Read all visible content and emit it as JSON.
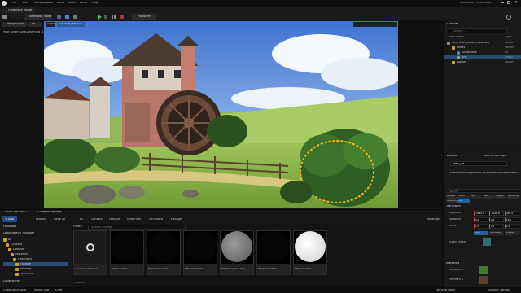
{
  "titlebar": {
    "project_tab": "FieldTrack_Asset",
    "window_title": "LowAngleV3_Shipped",
    "menu": [
      "File",
      "Edit",
      "Window",
      "Tools",
      "Build",
      "Select",
      "Actor",
      "Help"
    ]
  },
  "toolbar": {
    "mode_label": "Selection Mode",
    "platforms_label": "Platforms"
  },
  "viewport": {
    "perspective_label": "Perspective",
    "view_label": "Lit",
    "viewmode_label": "Show",
    "highlight_label": "Scalability: Medium",
    "pilot_label": "Pilot Actor: DirtGlassFlow_3"
  },
  "outliner": {
    "tab": "Outliner",
    "search_placeholder": "Search...",
    "column_label": "Item Label",
    "column_type": "Type",
    "items": [
      {
        "label": "FieldTrack_Assets (Editor)",
        "type": "World"
      },
      {
        "label": "Reset",
        "type": "Folder"
      },
      {
        "label": "Skysphere",
        "type": "BP"
      },
      {
        "label": "SM_",
        "type": "Static"
      },
      {
        "label": "Lights",
        "type": "Folder"
      }
    ],
    "footer": "Showing 2 of 1 Selection"
  },
  "details": {
    "tab": "Details",
    "world_settings_tab": "World Settings",
    "actor_name": "Tree_09",
    "component_line": "StaticMeshComponent (StaticMeshComponent0)",
    "search_placeholder": "Search",
    "filter_tabs": [
      "General",
      "Actor",
      "LOD",
      "Misc",
      "Physics",
      "Rendering",
      "Streaming",
      "All"
    ],
    "transform_label": "Transform",
    "location_label": "Location",
    "rotation_label": "Rotation",
    "scale_label": "Scale",
    "location": [
      "-3240.0",
      "-2100.0",
      "420.0"
    ],
    "rotation": [
      "0.0",
      "0.0",
      "15.0"
    ],
    "scale": [
      "1.0",
      "1.0",
      "1.0"
    ],
    "static_mesh_label": "Static Mesh",
    "materials_label": "Materials",
    "element0_label": "Element 0",
    "element1_label": "Element 1",
    "mobility_options": [
      "Static",
      "Stationary",
      "Movable"
    ]
  },
  "content_browser": {
    "tabs": [
      "Niora Render S",
      "Content Browser"
    ],
    "add_label": "+ Add",
    "import_label": "Import",
    "save_all_label": "Save All",
    "settings_label": "Settings",
    "breadcrumb": [
      "All",
      "Content",
      "LostAnt",
      "Materials",
      "Functions",
      "Foliage"
    ],
    "favorites_label": "Favorites",
    "project_label": "LowAngleV3_Shipped",
    "filters_label": "Filters",
    "search_placeholder": "Search Foliage",
    "tree": [
      "All",
      "Content",
      "LostAnt",
      "Materials",
      "Functions",
      "Foliage",
      "Meshes",
      "Textures"
    ],
    "collections_label": "Collections",
    "item_count": "7 items",
    "assets": [
      {
        "name": "Landscape/Normal",
        "kind": "icon"
      },
      {
        "name": "MF_ColorBlend",
        "kind": "dark"
      },
      {
        "name": "MF_DistanceFade",
        "kind": "dark"
      },
      {
        "name": "MF_FoliageWind",
        "kind": "dark"
      },
      {
        "name": "MF_FoliageShading",
        "kind": "grey"
      },
      {
        "name": "MF_FoliageMask",
        "kind": "dark"
      },
      {
        "name": "MF_VertexWind",
        "kind": "white"
      }
    ]
  },
  "statusbar": {
    "content_drawer": "Content Drawer",
    "output_log": "Output Log",
    "cmd": "Cmd",
    "derived_data": "Derived Data",
    "source_control": "Source Control"
  }
}
